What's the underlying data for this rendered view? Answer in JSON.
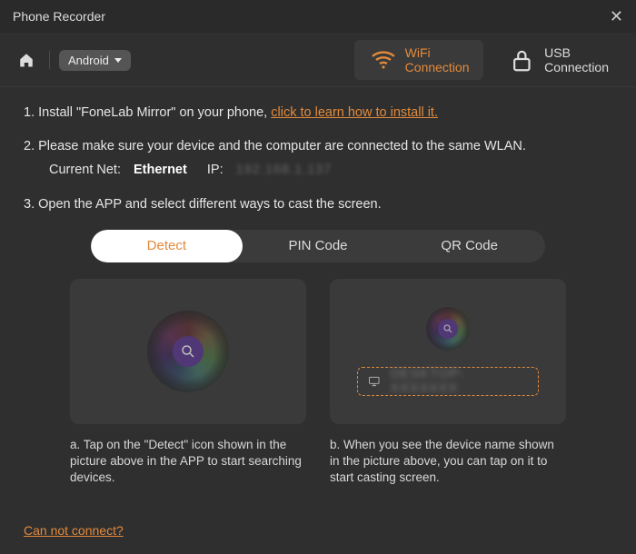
{
  "window": {
    "title": "Phone Recorder"
  },
  "toolbar": {
    "platform": "Android",
    "tabs": {
      "wifi": "WiFi Connection",
      "usb": "USB Connection"
    }
  },
  "steps": {
    "s1_prefix": "1. Install \"FoneLab Mirror\" on your phone, ",
    "s1_link": "click to learn how to install it.",
    "s2": "2. Please make sure your device and the computer are connected to the same WLAN.",
    "net_label": "Current Net:",
    "net_value": "Ethernet",
    "ip_label": "IP:",
    "ip_value": "192.168.1.137",
    "s3": "3. Open the APP and select different ways to cast the screen."
  },
  "cast_tabs": {
    "detect": "Detect",
    "pin": "PIN Code",
    "qr": "QR Code"
  },
  "captions": {
    "a": "a. Tap on the \"Detect\" icon shown in the picture above in the APP to start searching devices.",
    "b": "b. When you see the device name shown in the picture above, you can tap on it to start casting screen."
  },
  "device_placeholder": "DESKTOP-XXXXXXX",
  "footer": {
    "cannot": "Can not connect?"
  }
}
